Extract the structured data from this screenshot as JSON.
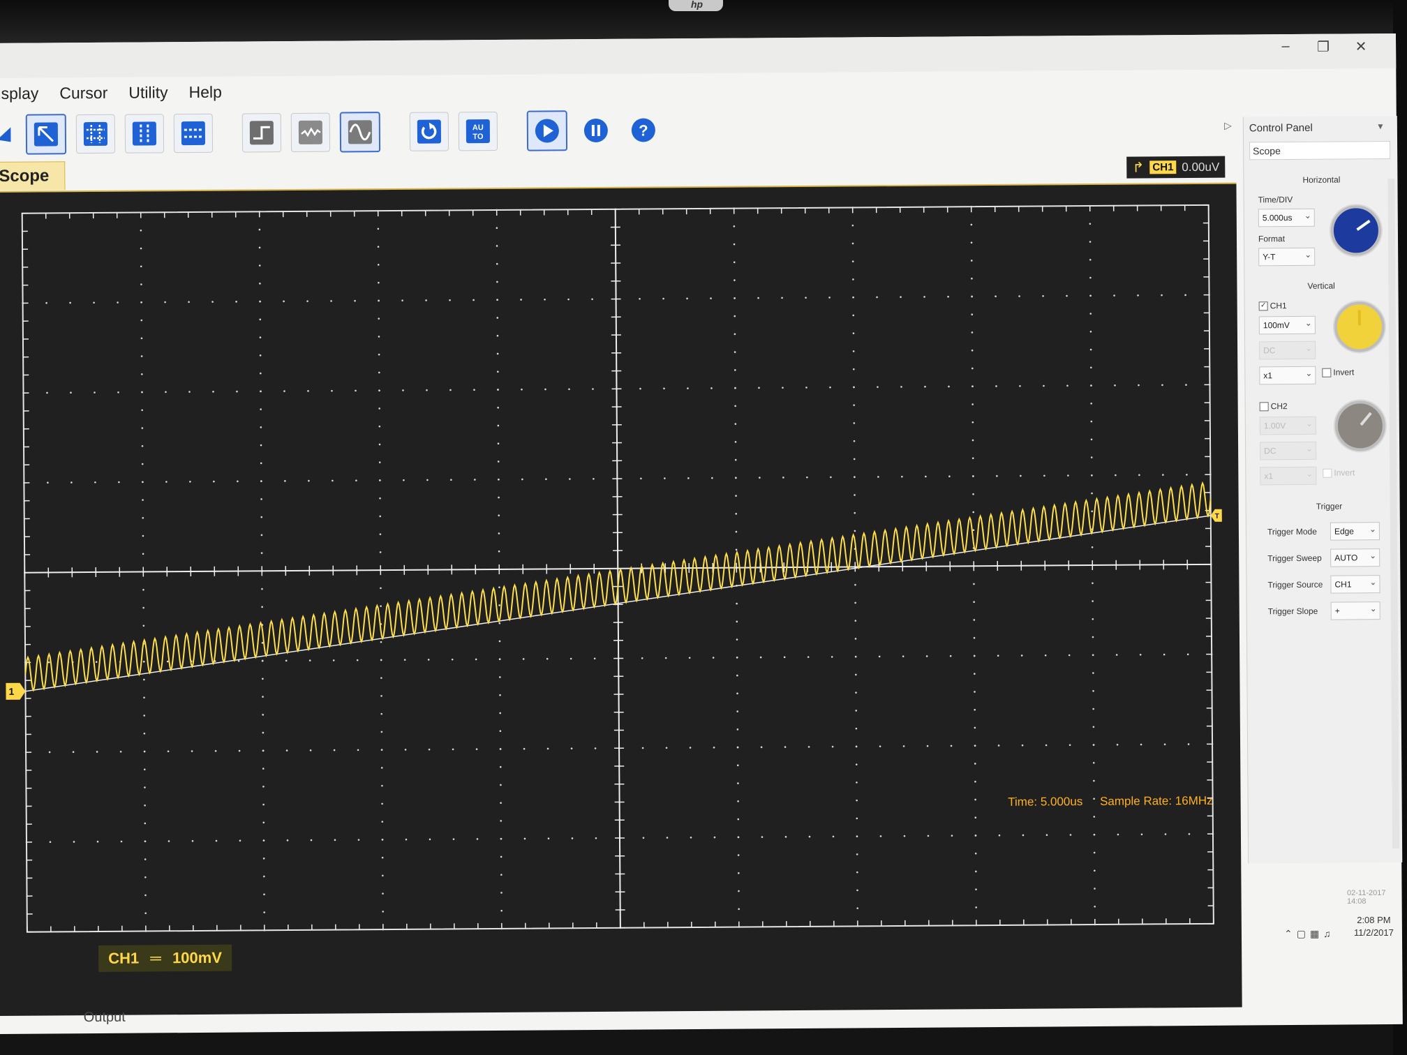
{
  "menu": [
    "isplay",
    "Cursor",
    "Utility",
    "Help"
  ],
  "toolbar": {
    "icons": [
      "left-arrow-icon",
      "pointer-icon",
      "grid-icon",
      "vertical-cursor-icon",
      "horizontal-cursor-icon",
      "step-wave-icon",
      "noise-wave-icon",
      "sine-wave-icon",
      "refresh-icon",
      "auto-icon",
      "run-icon",
      "pause-icon",
      "help-icon"
    ],
    "auto_label_1": "AU",
    "auto_label_2": "TO",
    "help_label": "?"
  },
  "tab": {
    "label": "Scope"
  },
  "trigger_status": {
    "channel": "CH1",
    "level": "0.00uV"
  },
  "channel_badge": {
    "channel": "CH1",
    "coupling": "═",
    "scale": "100mV"
  },
  "channel_marker": "1",
  "trigger_marker": "T",
  "readout": {
    "time": "Time: 5.000us",
    "sample_rate": "Sample Rate: 16MHz"
  },
  "panel": {
    "title": "Control Panel",
    "selector": "Scope",
    "horizontal": {
      "group": "Horizontal",
      "time_label": "Time/DIV",
      "time_value": "5.000us",
      "format_label": "Format",
      "format_value": "Y-T"
    },
    "vertical": {
      "group": "Vertical",
      "ch1": {
        "label": "CH1",
        "checked": true,
        "volts": "100mV",
        "coupling": "DC",
        "probe": "x1",
        "invert_label": "Invert"
      },
      "ch2": {
        "label": "CH2",
        "checked": false,
        "volts": "1.00V",
        "coupling": "DC",
        "probe": "x1",
        "invert_label": "Invert"
      }
    },
    "trigger": {
      "group": "Trigger",
      "mode_label": "Trigger Mode",
      "mode_value": "Edge",
      "sweep_label": "Trigger Sweep",
      "sweep_value": "AUTO",
      "source_label": "Trigger Source",
      "source_value": "CH1",
      "slope_label": "Trigger Slope",
      "slope_value": "+"
    },
    "knob_colors": {
      "horizontal": "#1d3a9e",
      "ch1": "#f2d23a",
      "ch2": "#8c8780"
    }
  },
  "waveform": {
    "color": "#ffe04a",
    "cycles_visible": 112
  },
  "colors": {
    "scope_bg": "#202020",
    "grid": "#d8d8d8",
    "accent": "#ffd84a",
    "readout": "#ffb020"
  },
  "output_label": "Output",
  "tray": {
    "time": "2:08 PM",
    "date": "11/2/2017",
    "date_faint": "02-11-2017 14:08"
  }
}
